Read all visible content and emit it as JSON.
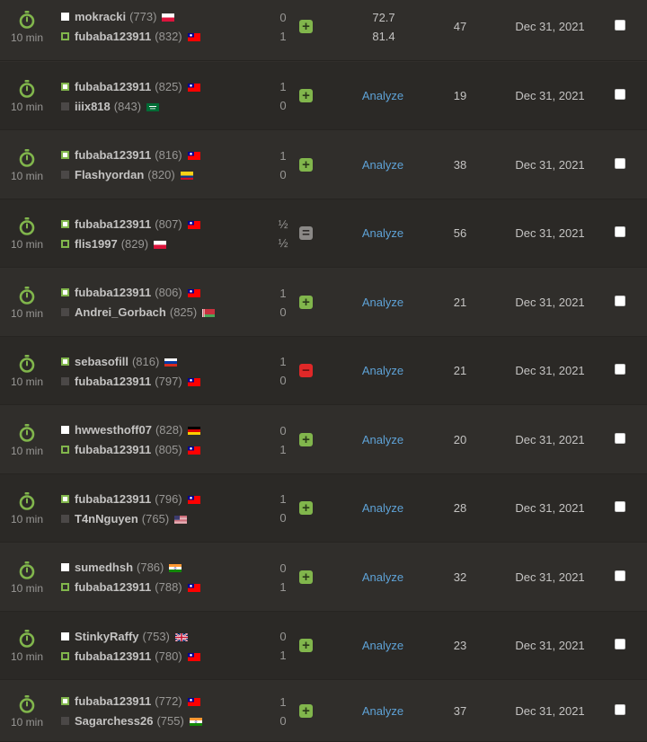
{
  "colors": {
    "win": "#81b64c",
    "draw": "#8b8987",
    "loss": "#e02828",
    "link": "#5ea2d6",
    "timeIcon": "#81b64c"
  },
  "games": [
    {
      "time_control": "10 min",
      "top": {
        "name": "mokracki",
        "rating": "(773)",
        "piece": "white",
        "won": false,
        "flag": "poland",
        "score": "0"
      },
      "bottom": {
        "name": "fubaba123911",
        "rating": "(832)",
        "piece": "black",
        "won": true,
        "flag": "taiwan",
        "score": "1"
      },
      "result": "win",
      "accuracy": [
        "72.7",
        "81.4"
      ],
      "moves": "47",
      "date": "Dec 31, 2021"
    },
    {
      "time_control": "10 min",
      "top": {
        "name": "fubaba123911",
        "rating": "(825)",
        "piece": "white",
        "won": true,
        "flag": "taiwan",
        "score": "1"
      },
      "bottom": {
        "name": "iiix818",
        "rating": "(843)",
        "piece": "black",
        "won": false,
        "flag": "saudi",
        "score": "0"
      },
      "result": "win",
      "analyze": "Analyze",
      "moves": "19",
      "date": "Dec 31, 2021"
    },
    {
      "time_control": "10 min",
      "top": {
        "name": "fubaba123911",
        "rating": "(816)",
        "piece": "white",
        "won": true,
        "flag": "taiwan",
        "score": "1"
      },
      "bottom": {
        "name": "Flashyordan",
        "rating": "(820)",
        "piece": "black",
        "won": false,
        "flag": "colombia",
        "score": "0"
      },
      "result": "win",
      "analyze": "Analyze",
      "moves": "38",
      "date": "Dec 31, 2021"
    },
    {
      "time_control": "10 min",
      "top": {
        "name": "fubaba123911",
        "rating": "(807)",
        "piece": "white",
        "won": true,
        "flag": "taiwan",
        "score": "½"
      },
      "bottom": {
        "name": "flis1997",
        "rating": "(829)",
        "piece": "black",
        "won": true,
        "flag": "poland",
        "score": "½"
      },
      "result": "draw",
      "analyze": "Analyze",
      "moves": "56",
      "date": "Dec 31, 2021"
    },
    {
      "time_control": "10 min",
      "top": {
        "name": "fubaba123911",
        "rating": "(806)",
        "piece": "white",
        "won": true,
        "flag": "taiwan",
        "score": "1"
      },
      "bottom": {
        "name": "Andrei_Gorbach",
        "rating": "(825)",
        "piece": "black",
        "won": false,
        "flag": "belarus",
        "score": "0"
      },
      "result": "win",
      "analyze": "Analyze",
      "moves": "21",
      "date": "Dec 31, 2021"
    },
    {
      "time_control": "10 min",
      "top": {
        "name": "sebasofill",
        "rating": "(816)",
        "piece": "white",
        "won": true,
        "flag": "russia",
        "score": "1"
      },
      "bottom": {
        "name": "fubaba123911",
        "rating": "(797)",
        "piece": "black",
        "won": false,
        "flag": "taiwan",
        "score": "0"
      },
      "result": "loss",
      "analyze": "Analyze",
      "moves": "21",
      "date": "Dec 31, 2021"
    },
    {
      "time_control": "10 min",
      "top": {
        "name": "hwwesthoff07",
        "rating": "(828)",
        "piece": "white",
        "won": false,
        "flag": "germany",
        "score": "0"
      },
      "bottom": {
        "name": "fubaba123911",
        "rating": "(805)",
        "piece": "black",
        "won": true,
        "flag": "taiwan",
        "score": "1"
      },
      "result": "win",
      "analyze": "Analyze",
      "moves": "20",
      "date": "Dec 31, 2021"
    },
    {
      "time_control": "10 min",
      "top": {
        "name": "fubaba123911",
        "rating": "(796)",
        "piece": "white",
        "won": true,
        "flag": "taiwan",
        "score": "1"
      },
      "bottom": {
        "name": "T4nNguyen",
        "rating": "(765)",
        "piece": "black",
        "won": false,
        "flag": "usa",
        "score": "0"
      },
      "result": "win",
      "analyze": "Analyze",
      "moves": "28",
      "date": "Dec 31, 2021"
    },
    {
      "time_control": "10 min",
      "top": {
        "name": "sumedhsh",
        "rating": "(786)",
        "piece": "white",
        "won": false,
        "flag": "india",
        "score": "0"
      },
      "bottom": {
        "name": "fubaba123911",
        "rating": "(788)",
        "piece": "black",
        "won": true,
        "flag": "taiwan",
        "score": "1"
      },
      "result": "win",
      "analyze": "Analyze",
      "moves": "32",
      "date": "Dec 31, 2021"
    },
    {
      "time_control": "10 min",
      "top": {
        "name": "StinkyRaffy",
        "rating": "(753)",
        "piece": "white",
        "won": false,
        "flag": "uk",
        "score": "0"
      },
      "bottom": {
        "name": "fubaba123911",
        "rating": "(780)",
        "piece": "black",
        "won": true,
        "flag": "taiwan",
        "score": "1"
      },
      "result": "win",
      "analyze": "Analyze",
      "moves": "23",
      "date": "Dec 31, 2021"
    },
    {
      "time_control": "10 min",
      "top": {
        "name": "fubaba123911",
        "rating": "(772)",
        "piece": "white",
        "won": true,
        "flag": "taiwan",
        "score": "1"
      },
      "bottom": {
        "name": "Sagarchess26",
        "rating": "(755)",
        "piece": "black",
        "won": false,
        "flag": "india",
        "score": "0"
      },
      "result": "win",
      "analyze": "Analyze",
      "moves": "37",
      "date": "Dec 31, 2021"
    }
  ]
}
